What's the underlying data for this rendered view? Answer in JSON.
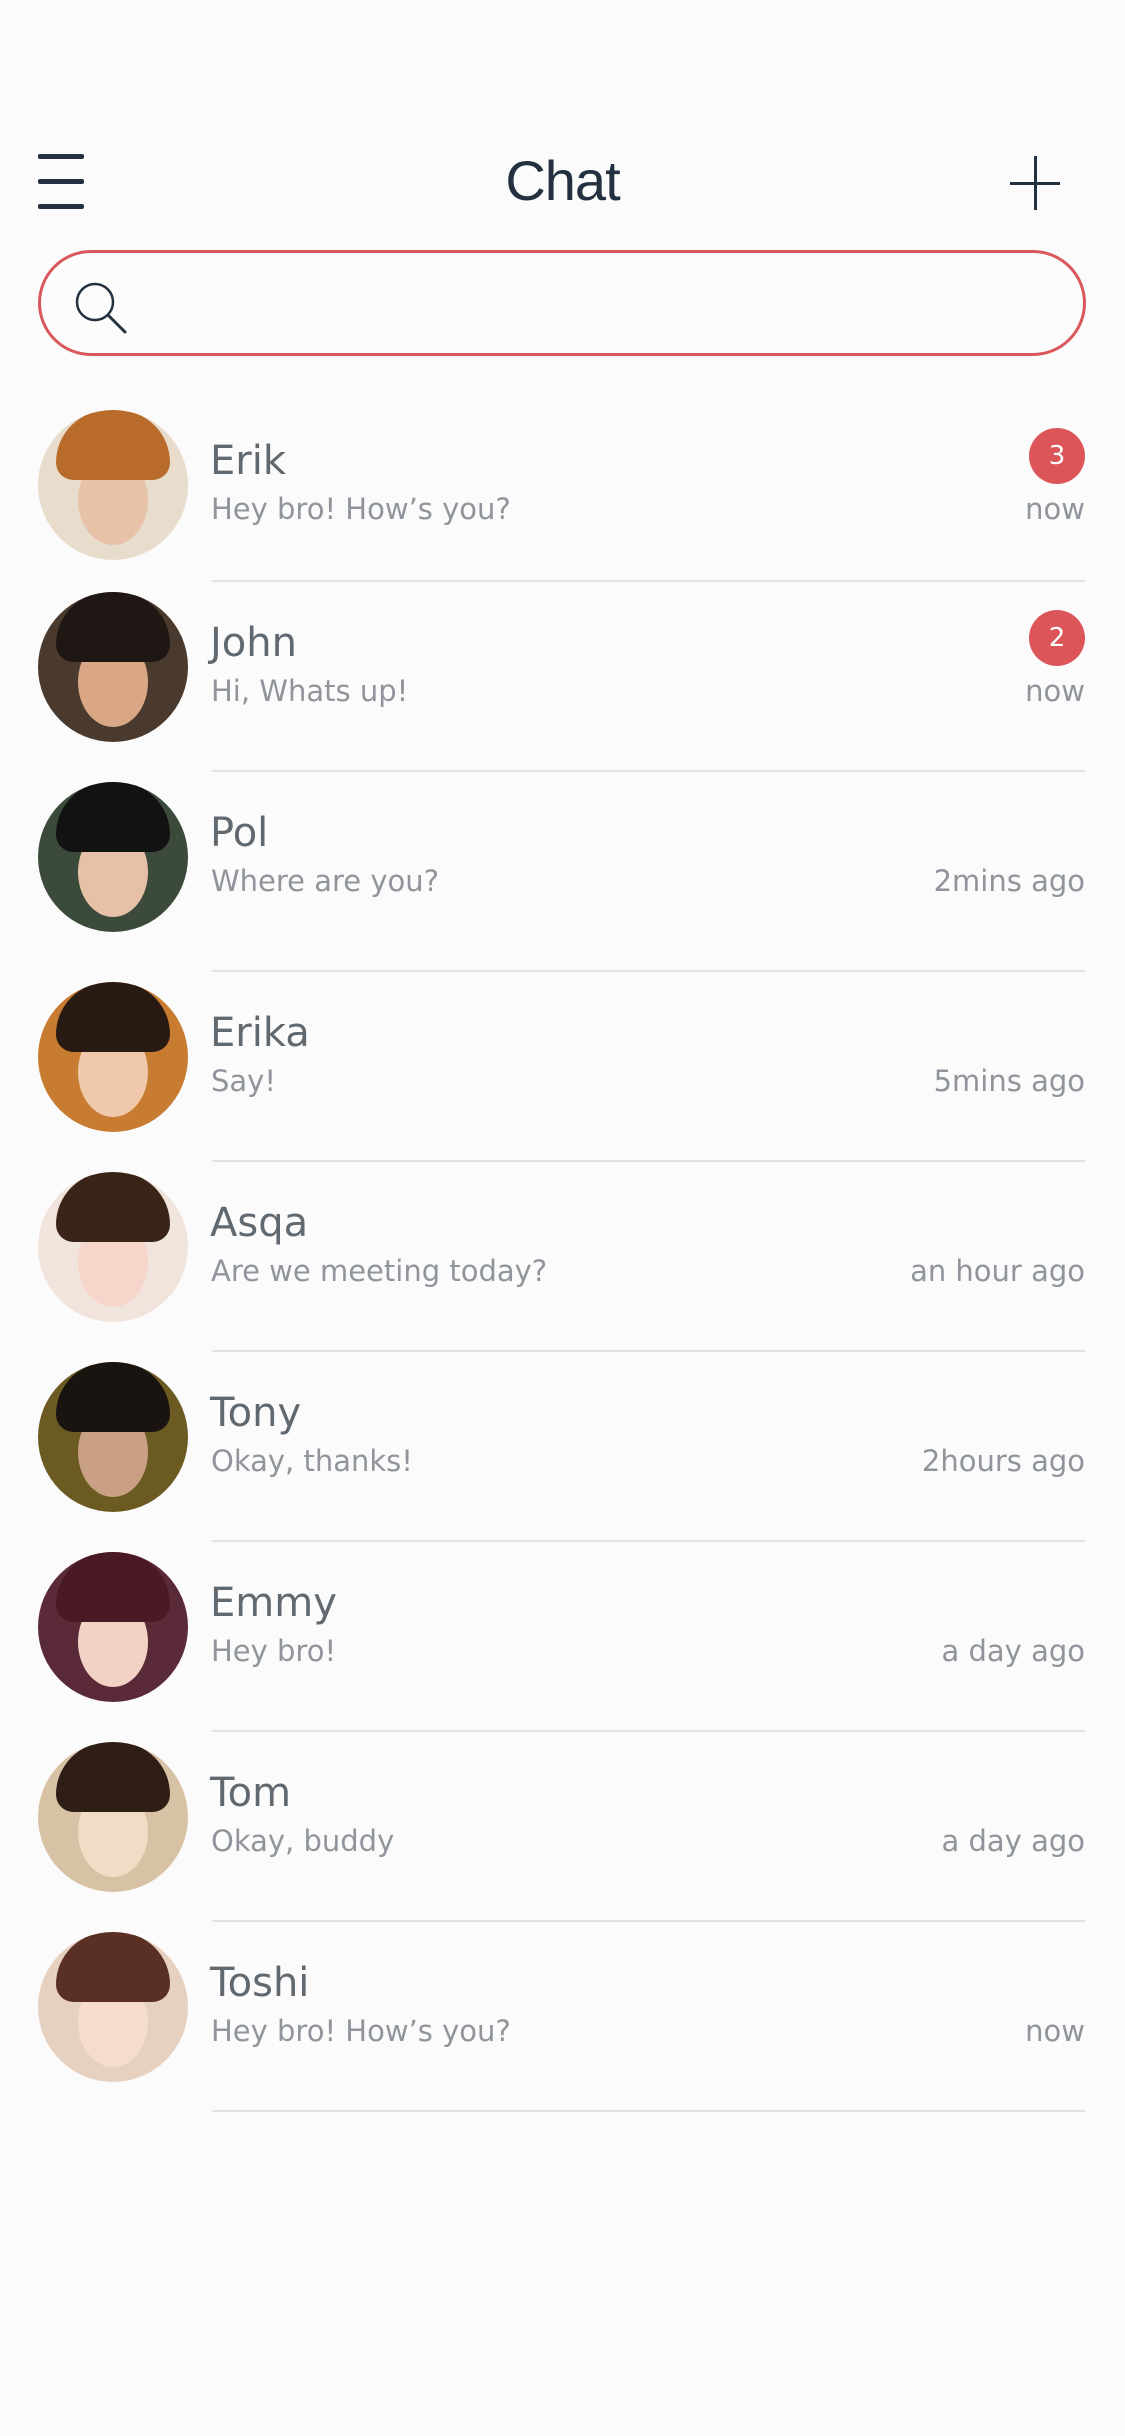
{
  "header": {
    "title": "Chat"
  },
  "search": {
    "placeholder": "",
    "value": ""
  },
  "colors": {
    "accent": "#dc5558",
    "title": "#23303f",
    "name": "#606870",
    "secondary": "#8f959b",
    "divider": "#e2e2e2"
  },
  "chats": [
    {
      "name": "Erik",
      "message": "Hey bro! How’s you?",
      "time": "now",
      "badge": "3",
      "skin": "#e8c2a8",
      "hair": "#b86b2a",
      "bg": "#e8dccc"
    },
    {
      "name": "John",
      "message": "Hi, Whats up!",
      "time": "now",
      "badge": "2",
      "skin": "#d9a785",
      "hair": "#1e1713",
      "bg": "#4a3a2e"
    },
    {
      "name": "Pol",
      "message": "Where are you?",
      "time": "2mins ago",
      "badge": "",
      "skin": "#e6c1a8",
      "hair": "#121212",
      "bg": "#3b4a3a"
    },
    {
      "name": "Erika",
      "message": "Say!",
      "time": "5mins ago",
      "badge": "",
      "skin": "#f0c9ad",
      "hair": "#2a1a14",
      "bg": "#c87c32"
    },
    {
      "name": "Asqa",
      "message": "Are we meeting today?",
      "time": "an hour ago",
      "badge": "",
      "skin": "#f6d6cb",
      "hair": "#3a2418",
      "bg": "#f1e4dc"
    },
    {
      "name": "Tony",
      "message": "Okay, thanks!",
      "time": "2hours ago",
      "badge": "",
      "skin": "#c9a084",
      "hair": "#1a1410",
      "bg": "#6b5a22"
    },
    {
      "name": "Emmy",
      "message": "Hey bro!",
      "time": "a day ago",
      "badge": "",
      "skin": "#f2d2c4",
      "hair": "#4a1a24",
      "bg": "#5a2a38"
    },
    {
      "name": "Tom",
      "message": "Okay, buddy",
      "time": "a day ago",
      "badge": "",
      "skin": "#f1dcc6",
      "hair": "#2e1e16",
      "bg": "#d8c2a6"
    },
    {
      "name": "Toshi",
      "message": "Hey bro! How’s you?",
      "time": "now",
      "badge": "",
      "skin": "#f6dccc",
      "hair": "#5a3024",
      "bg": "#e6d0c0"
    }
  ]
}
